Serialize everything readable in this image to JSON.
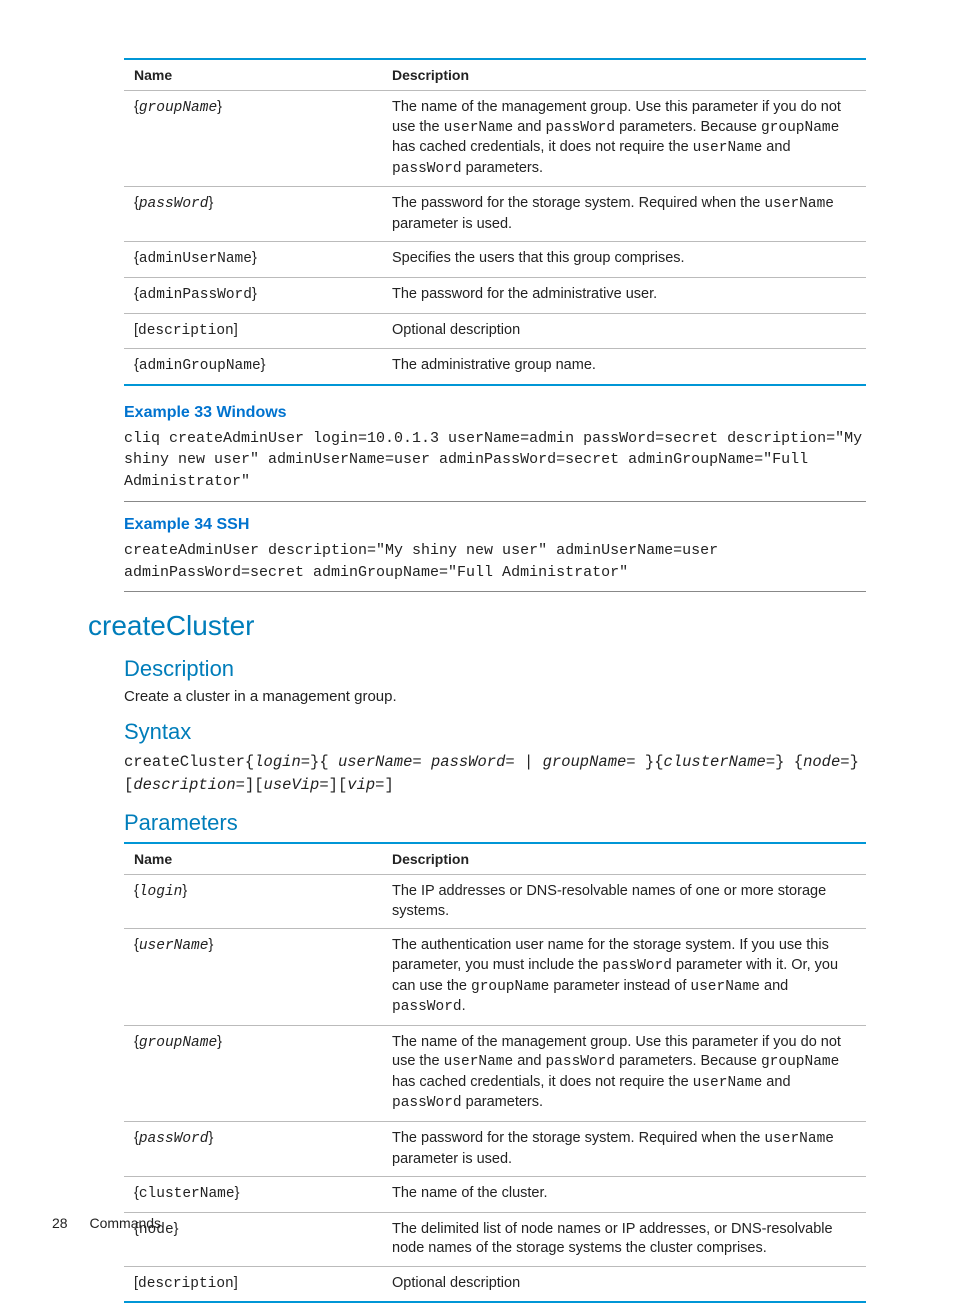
{
  "table1": {
    "headers": {
      "name": "Name",
      "desc": "Description"
    },
    "rows": [
      {
        "name_pre": "{",
        "name_code": "groupName",
        "name_post": "}",
        "name_ital": true,
        "desc_parts": [
          {
            "t": "The name of the management group. Use this parameter if you do not use the "
          },
          {
            "t": "userName",
            "c": true
          },
          {
            "t": " and "
          },
          {
            "t": "passWord",
            "c": true
          },
          {
            "t": " parameters. Because "
          },
          {
            "t": "groupName",
            "c": true
          },
          {
            "t": " has cached credentials, it does not require the "
          },
          {
            "t": "userName",
            "c": true
          },
          {
            "t": " and "
          },
          {
            "t": "passWord",
            "c": true
          },
          {
            "t": " parameters."
          }
        ]
      },
      {
        "name_pre": "{",
        "name_code": "passWord",
        "name_post": "}",
        "name_ital": true,
        "desc_parts": [
          {
            "t": "The password for the storage system. Required when the "
          },
          {
            "t": "userName",
            "c": true
          },
          {
            "t": " parameter is used."
          }
        ]
      },
      {
        "name_pre": "{",
        "name_code": "adminUserName",
        "name_post": "}",
        "name_ital": false,
        "desc_parts": [
          {
            "t": "Specifies the users that this group comprises."
          }
        ]
      },
      {
        "name_pre": "{",
        "name_code": "adminPassWord",
        "name_post": "}",
        "name_ital": false,
        "desc_parts": [
          {
            "t": "The password for the administrative user."
          }
        ]
      },
      {
        "name_pre": "[",
        "name_code": "description",
        "name_post": "]",
        "name_ital": false,
        "desc_parts": [
          {
            "t": "Optional description"
          }
        ]
      },
      {
        "name_pre": "{",
        "name_code": "adminGroupName",
        "name_post": "}",
        "name_ital": false,
        "desc_parts": [
          {
            "t": "The administrative group name."
          }
        ]
      }
    ]
  },
  "example33": {
    "title": "Example 33 Windows",
    "code": "cliq createAdminUser login=10.0.1.3 userName=admin passWord=secret description=\"My shiny new user\" adminUserName=user adminPassWord=secret adminGroupName=\"Full Administrator\""
  },
  "example34": {
    "title": "Example 34 SSH",
    "code": "createAdminUser description=\"My shiny new user\" adminUserName=user adminPassWord=secret adminGroupName=\"Full Administrator\""
  },
  "createCluster": {
    "title": "createCluster",
    "descHeading": "Description",
    "descText": "Create a cluster in a management group.",
    "syntaxHeading": "Syntax",
    "syntax": {
      "cmd": "createCluster",
      "parts": [
        {
          "t": "{"
        },
        {
          "t": "login=",
          "i": true
        },
        {
          "t": "}{ "
        },
        {
          "t": "userName= passWord= ",
          "i": true
        },
        {
          "t": "| "
        },
        {
          "t": "groupName= ",
          "i": true
        },
        {
          "t": "}{"
        },
        {
          "t": "clusterName=",
          "i": true
        },
        {
          "t": "} {"
        },
        {
          "t": "node=",
          "i": true
        },
        {
          "t": "}["
        },
        {
          "t": "description=",
          "i": true
        },
        {
          "t": "]["
        },
        {
          "t": "useVip=",
          "i": true
        },
        {
          "t": "]["
        },
        {
          "t": "vip=",
          "i": true
        },
        {
          "t": "]"
        }
      ]
    },
    "paramsHeading": "Parameters"
  },
  "table2": {
    "headers": {
      "name": "Name",
      "desc": "Description"
    },
    "rows": [
      {
        "name_pre": "{",
        "name_code": "login",
        "name_post": "}",
        "name_ital": true,
        "desc_parts": [
          {
            "t": "The IP addresses or DNS-resolvable names of one or more storage systems."
          }
        ]
      },
      {
        "name_pre": "{",
        "name_code": "userName",
        "name_post": "}",
        "name_ital": true,
        "desc_parts": [
          {
            "t": "The authentication user name for the storage system. If you use this parameter, you must include the "
          },
          {
            "t": "passWord",
            "c": true
          },
          {
            "t": " parameter with it. Or, you can use the "
          },
          {
            "t": "groupName",
            "c": true
          },
          {
            "t": " parameter instead of "
          },
          {
            "t": "userName",
            "c": true
          },
          {
            "t": " and "
          },
          {
            "t": "passWord",
            "c": true
          },
          {
            "t": "."
          }
        ]
      },
      {
        "name_pre": "{",
        "name_code": "groupName",
        "name_post": "}",
        "name_ital": true,
        "desc_parts": [
          {
            "t": "The name of the management group. Use this parameter if you do not use the "
          },
          {
            "t": "userName",
            "c": true
          },
          {
            "t": " and "
          },
          {
            "t": "passWord",
            "c": true
          },
          {
            "t": " parameters. Because "
          },
          {
            "t": "groupName",
            "c": true
          },
          {
            "t": " has cached credentials, it does not require the "
          },
          {
            "t": "userName",
            "c": true
          },
          {
            "t": " and "
          },
          {
            "t": "passWord",
            "c": true
          },
          {
            "t": " parameters."
          }
        ]
      },
      {
        "name_pre": "{",
        "name_code": "passWord",
        "name_post": "}",
        "name_ital": true,
        "desc_parts": [
          {
            "t": "The password for the storage system. Required when the "
          },
          {
            "t": "userName",
            "c": true
          },
          {
            "t": " parameter is used."
          }
        ]
      },
      {
        "name_pre": "{",
        "name_code": "clusterName",
        "name_post": "}",
        "name_ital": false,
        "desc_parts": [
          {
            "t": "The name of the cluster."
          }
        ]
      },
      {
        "name_pre": "{",
        "name_code": "node",
        "name_post": "}",
        "name_ital": false,
        "desc_parts": [
          {
            "t": "The delimited list of node names or IP addresses, or DNS-resolvable node names of the storage systems the cluster comprises."
          }
        ]
      },
      {
        "name_pre": "[",
        "name_code": "description",
        "name_post": "]",
        "name_ital": false,
        "desc_parts": [
          {
            "t": "Optional description"
          }
        ]
      }
    ]
  },
  "footer": {
    "page": "28",
    "section": "Commands"
  }
}
